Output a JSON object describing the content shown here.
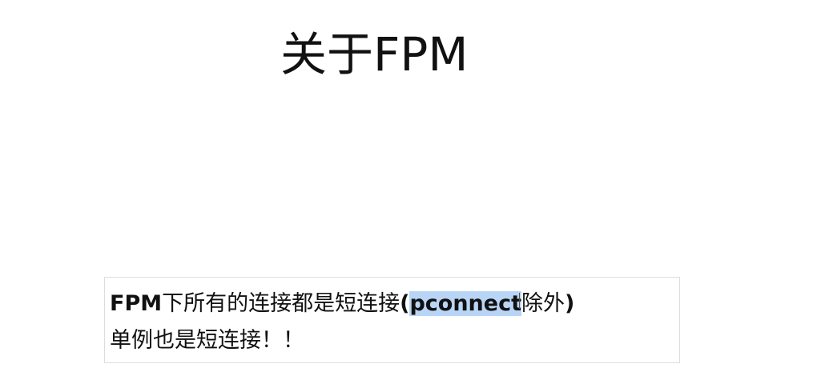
{
  "slide": {
    "title": "关于FPM",
    "body": {
      "line1": {
        "bold_prefix": "FPM",
        "text": "下所有的连接都是短连接",
        "paren_open": "(",
        "highlight": "pconnect",
        "text_after": "除外",
        "paren_close": ")"
      },
      "line2": "单例也是短连接！！"
    }
  },
  "colors": {
    "selection": "#b9d5f6",
    "text": "#111111",
    "box_border": "#dcdcdc"
  }
}
